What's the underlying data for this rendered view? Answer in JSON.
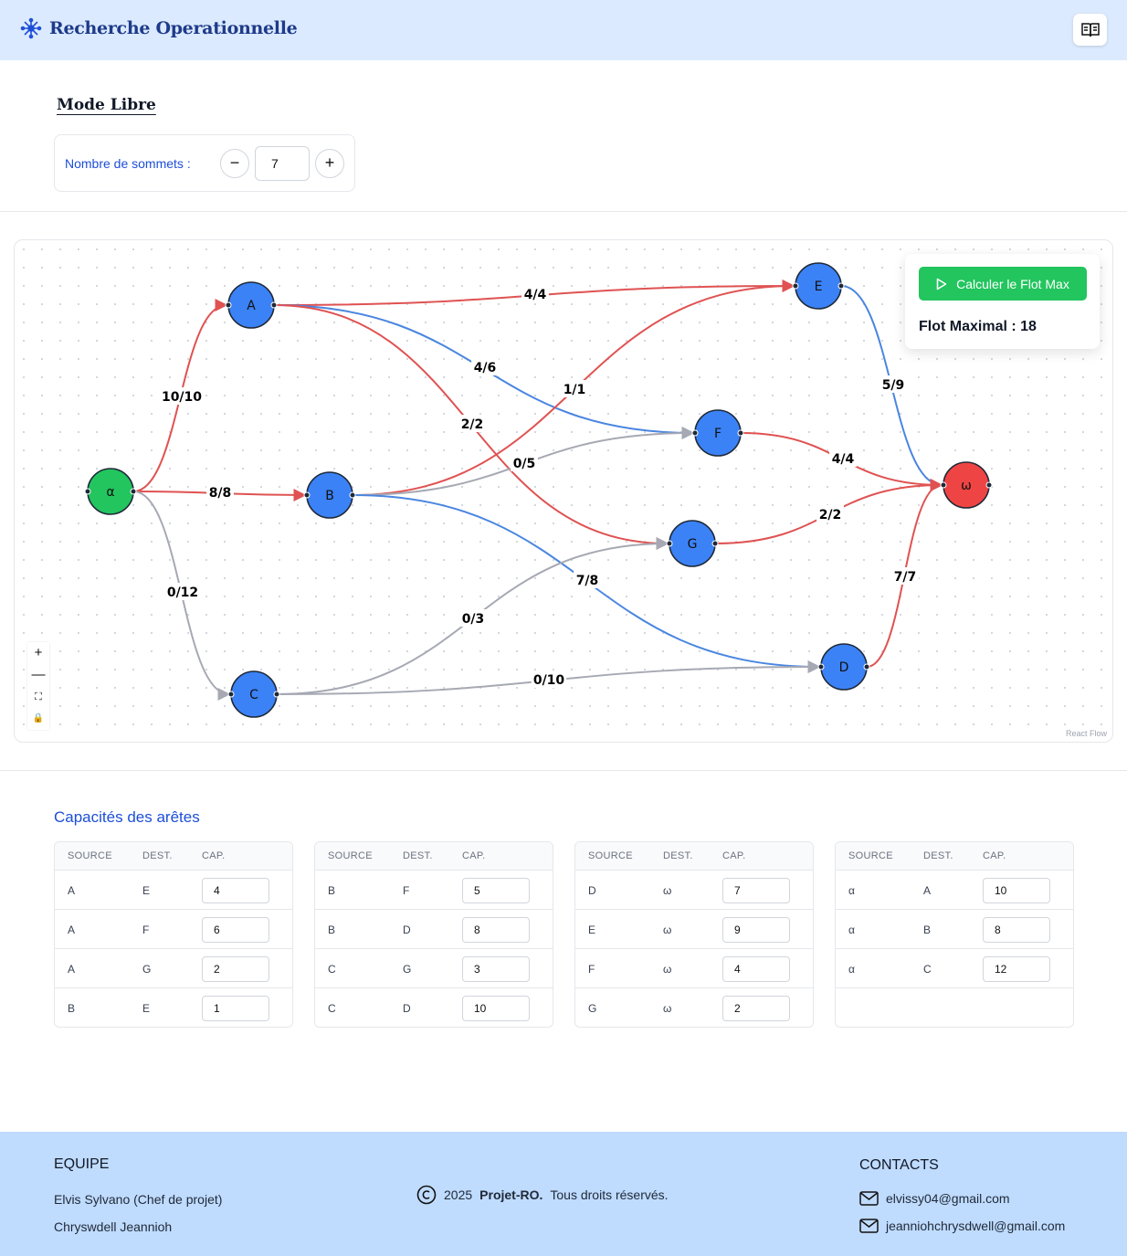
{
  "header": {
    "brand": "Recherche Operationnelle",
    "guide_icon": "book-open-icon"
  },
  "mode": {
    "title": "Mode Libre",
    "vertex_count_label": "Nombre de sommets :",
    "vertex_count": "7",
    "decrement": "−",
    "increment": "+"
  },
  "graph": {
    "nodes": [
      {
        "id": "α",
        "color": "#22c55e"
      },
      {
        "id": "A",
        "color": "#3b82f6"
      },
      {
        "id": "B",
        "color": "#3b82f6"
      },
      {
        "id": "C",
        "color": "#3b82f6"
      },
      {
        "id": "D",
        "color": "#3b82f6"
      },
      {
        "id": "E",
        "color": "#3b82f6"
      },
      {
        "id": "F",
        "color": "#3b82f6"
      },
      {
        "id": "G",
        "color": "#3b82f6"
      },
      {
        "id": "ω",
        "color": "#ef4444"
      }
    ],
    "edges": [
      {
        "from": "α",
        "to": "A",
        "label": "10/10",
        "state": "saturated"
      },
      {
        "from": "α",
        "to": "B",
        "label": "8/8",
        "state": "saturated"
      },
      {
        "from": "α",
        "to": "C",
        "label": "0/12",
        "state": "empty"
      },
      {
        "from": "A",
        "to": "E",
        "label": "4/4",
        "state": "saturated"
      },
      {
        "from": "A",
        "to": "F",
        "label": "4/6",
        "state": "partial"
      },
      {
        "from": "A",
        "to": "G",
        "label": "2/2",
        "state": "saturated"
      },
      {
        "from": "B",
        "to": "E",
        "label": "1/1",
        "state": "saturated"
      },
      {
        "from": "B",
        "to": "F",
        "label": "0/5",
        "state": "empty"
      },
      {
        "from": "B",
        "to": "D",
        "label": "7/8",
        "state": "partial"
      },
      {
        "from": "C",
        "to": "G",
        "label": "0/3",
        "state": "empty"
      },
      {
        "from": "C",
        "to": "D",
        "label": "0/10",
        "state": "empty"
      },
      {
        "from": "E",
        "to": "ω",
        "label": "5/9",
        "state": "partial"
      },
      {
        "from": "F",
        "to": "ω",
        "label": "4/4",
        "state": "saturated"
      },
      {
        "from": "G",
        "to": "ω",
        "label": "2/2",
        "state": "saturated"
      },
      {
        "from": "D",
        "to": "ω",
        "label": "7/7",
        "state": "saturated"
      }
    ],
    "edge_colors": {
      "saturated": "#e05252",
      "partial": "#4a86e0",
      "empty": "#a6a9b3"
    },
    "controls": {
      "zoom_in": "+",
      "zoom_out": "—",
      "fit": "⛶",
      "lock": "🔒"
    },
    "attribution": "React Flow"
  },
  "calc": {
    "button": "Calculer le Flot Max",
    "result": "Flot Maximal : 18",
    "accent": "#22c55e"
  },
  "capacities": {
    "title": "Capacités des arêtes",
    "headers": [
      "SOURCE",
      "DEST.",
      "CAP."
    ],
    "tables": [
      [
        {
          "src": "A",
          "dst": "E",
          "cap": "4"
        },
        {
          "src": "A",
          "dst": "F",
          "cap": "6"
        },
        {
          "src": "A",
          "dst": "G",
          "cap": "2"
        },
        {
          "src": "B",
          "dst": "E",
          "cap": "1"
        }
      ],
      [
        {
          "src": "B",
          "dst": "F",
          "cap": "5"
        },
        {
          "src": "B",
          "dst": "D",
          "cap": "8"
        },
        {
          "src": "C",
          "dst": "G",
          "cap": "3"
        },
        {
          "src": "C",
          "dst": "D",
          "cap": "10"
        }
      ],
      [
        {
          "src": "D",
          "dst": "ω",
          "cap": "7"
        },
        {
          "src": "E",
          "dst": "ω",
          "cap": "9"
        },
        {
          "src": "F",
          "dst": "ω",
          "cap": "4"
        },
        {
          "src": "G",
          "dst": "ω",
          "cap": "2"
        }
      ],
      [
        {
          "src": "α",
          "dst": "A",
          "cap": "10"
        },
        {
          "src": "α",
          "dst": "B",
          "cap": "8"
        },
        {
          "src": "α",
          "dst": "C",
          "cap": "12"
        }
      ]
    ]
  },
  "footer": {
    "team_title": "EQUIPE",
    "members": [
      "Elvis Sylvano (Chef de projet)",
      "Chryswdell Jeannioh"
    ],
    "copyright_year": "2025",
    "copyright_project": "Projet-RO.",
    "copyright_rest": "Tous droits réservés.",
    "contacts_title": "CONTACTS",
    "emails": [
      "elvissy04@gmail.com",
      "jeanniohchrysdwell@gmail.com"
    ]
  }
}
